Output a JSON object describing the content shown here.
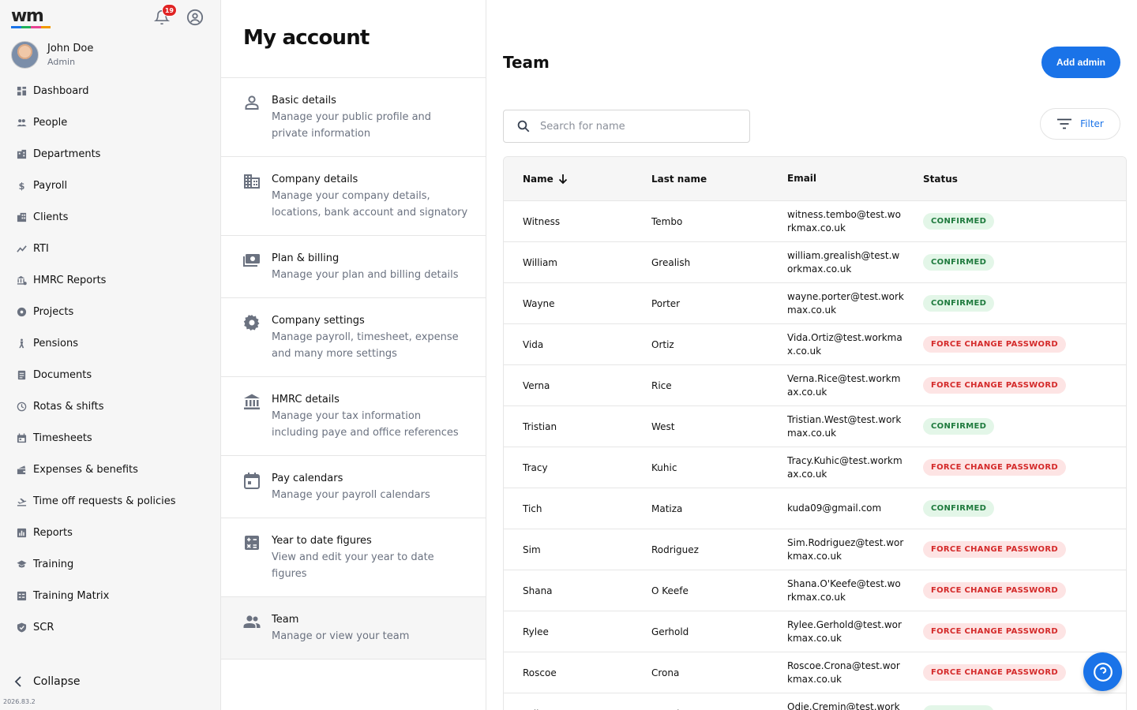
{
  "app": {
    "logo_text": "wm",
    "logo_colors": [
      "#1a73e8",
      "#20b15a",
      "#e84393",
      "#f29900"
    ],
    "notification_count": "19",
    "version": "2026.83.2"
  },
  "user": {
    "name": "John Doe",
    "role": "Admin"
  },
  "sidebar": {
    "items": [
      {
        "label": "Dashboard",
        "icon": "dashboard-icon"
      },
      {
        "label": "People",
        "icon": "people-icon"
      },
      {
        "label": "Departments",
        "icon": "building-icon"
      },
      {
        "label": "Payroll",
        "icon": "dollar-icon"
      },
      {
        "label": "Clients",
        "icon": "clients-icon"
      },
      {
        "label": "RTI",
        "icon": "trend-icon"
      },
      {
        "label": "HMRC Reports",
        "icon": "bank-report-icon"
      },
      {
        "label": "Projects",
        "icon": "projects-icon"
      },
      {
        "label": "Pensions",
        "icon": "pension-icon"
      },
      {
        "label": "Documents",
        "icon": "document-icon"
      },
      {
        "label": "Rotas & shifts",
        "icon": "clock-icon"
      },
      {
        "label": "Timesheets",
        "icon": "calendar-icon"
      },
      {
        "label": "Expenses & benefits",
        "icon": "expenses-icon"
      },
      {
        "label": "Time off requests & policies",
        "icon": "plane-icon"
      },
      {
        "label": "Reports",
        "icon": "report-icon"
      },
      {
        "label": "Training",
        "icon": "graduation-icon"
      },
      {
        "label": "Training Matrix",
        "icon": "matrix-icon"
      },
      {
        "label": "SCR",
        "icon": "shield-icon"
      }
    ],
    "collapse_label": "Collapse"
  },
  "account": {
    "title": "My account",
    "menu": [
      {
        "title": "Basic details",
        "desc": "Manage your public profile and private information",
        "icon": "person-icon"
      },
      {
        "title": "Company details",
        "desc": "Manage your company details, locations, bank account and signatory",
        "icon": "company-icon"
      },
      {
        "title": "Plan & billing",
        "desc": "Manage your plan and billing details",
        "icon": "billing-icon"
      },
      {
        "title": "Company settings",
        "desc": "Manage payroll, timesheet, expense and many more settings",
        "icon": "settings-icon"
      },
      {
        "title": "HMRC details",
        "desc": "Manage your tax information including paye and office references",
        "icon": "bank-icon"
      },
      {
        "title": "Pay calendars",
        "desc": "Manage your payroll calendars",
        "icon": "calendar-icon"
      },
      {
        "title": "Year to date figures",
        "desc": "View and edit your year to date figures",
        "icon": "calculator-icon"
      },
      {
        "title": "Team",
        "desc": "Manage or view your team",
        "icon": "team-icon"
      }
    ],
    "active_index": 7
  },
  "team": {
    "title": "Team",
    "add_button": "Add admin",
    "search_placeholder": "Search for name",
    "filter_label": "Filter",
    "columns": [
      "Name",
      "Last name",
      "Email",
      "Status"
    ],
    "rows": [
      {
        "name": "Witness",
        "last": "Tembo",
        "email": "witness.tembo@test.workmax.co.uk",
        "status": "CONFIRMED"
      },
      {
        "name": "William",
        "last": "Grealish",
        "email": "william.grealish@test.workmax.co.uk",
        "status": "CONFIRMED"
      },
      {
        "name": "Wayne",
        "last": "Porter",
        "email": "wayne.porter@test.workmax.co.uk",
        "status": "CONFIRMED"
      },
      {
        "name": "Vida",
        "last": "Ortiz",
        "email": "Vida.Ortiz@test.workmax.co.uk",
        "status": "FORCE CHANGE PASSWORD"
      },
      {
        "name": "Verna",
        "last": "Rice",
        "email": "Verna.Rice@test.workmax.co.uk",
        "status": "FORCE CHANGE PASSWORD"
      },
      {
        "name": "Tristian",
        "last": "West",
        "email": "Tristian.West@test.workmax.co.uk",
        "status": "CONFIRMED"
      },
      {
        "name": "Tracy",
        "last": "Kuhic",
        "email": "Tracy.Kuhic@test.workmax.co.uk",
        "status": "FORCE CHANGE PASSWORD"
      },
      {
        "name": "Tich",
        "last": "Matiza",
        "email": "kuda09@gmail.com",
        "status": "CONFIRMED"
      },
      {
        "name": "Sim",
        "last": "Rodriguez",
        "email": "Sim.Rodriguez@test.workmax.co.uk",
        "status": "FORCE CHANGE PASSWORD"
      },
      {
        "name": "Shana",
        "last": "O Keefe",
        "email": "Shana.O'Keefe@test.workmax.co.uk",
        "status": "FORCE CHANGE PASSWORD"
      },
      {
        "name": "Rylee",
        "last": "Gerhold",
        "email": "Rylee.Gerhold@test.workmax.co.uk",
        "status": "FORCE CHANGE PASSWORD"
      },
      {
        "name": "Roscoe",
        "last": "Crona",
        "email": "Roscoe.Crona@test.workmax.co.uk",
        "status": "FORCE CHANGE PASSWORD"
      },
      {
        "name": "Odie",
        "last": "Cremin",
        "email": "Odie.Cremin@test.workmax.co.uk",
        "status": "CONFIRMED"
      }
    ]
  }
}
